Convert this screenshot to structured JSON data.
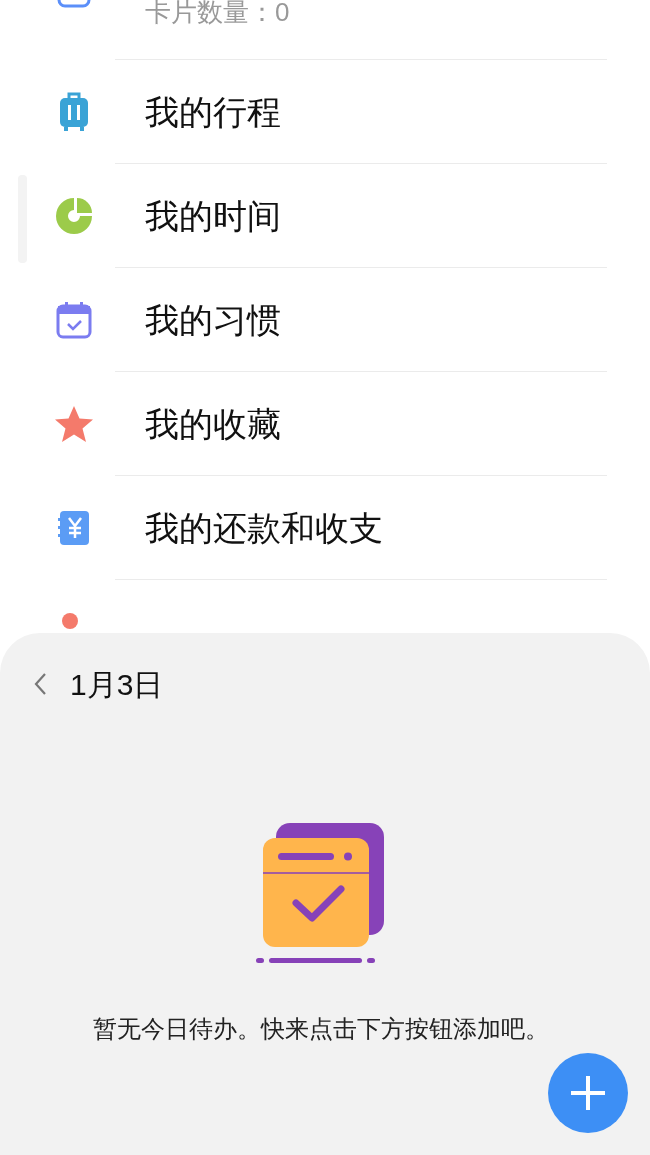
{
  "list_items": [
    {
      "kind": "card",
      "label": "卡片数量：0"
    },
    {
      "kind": "suitcase",
      "label": "我的行程"
    },
    {
      "kind": "time",
      "label": "我的时间"
    },
    {
      "kind": "habit",
      "label": "我的习惯"
    },
    {
      "kind": "star",
      "label": "我的收藏"
    },
    {
      "kind": "money",
      "label": "我的还款和收支"
    },
    {
      "kind": "guard"
    }
  ],
  "sheet": {
    "date": "1月3日",
    "empty_message": "暂无今日待办。快来点击下方按钮添加吧。"
  }
}
